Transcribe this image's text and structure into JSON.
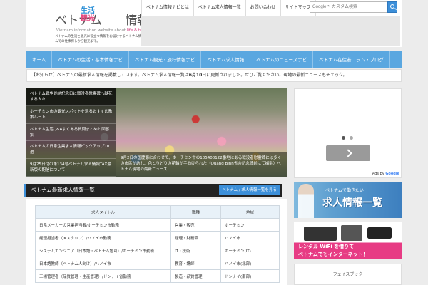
{
  "header": {
    "logo_main": "ベトナム　　情報ナビ",
    "logo_stack_top": "生活",
    "logo_stack_bottom": "観光",
    "logo_tagline_prefix": "Vietnam information website about ",
    "logo_tagline_accent": "life & travel",
    "site_description": "ベトナムの生活と観光に役立つ情報をお届けするベトナム情報サイト。ベトナムでの仕事探しから観光まで。"
  },
  "top_nav": [
    {
      "label": "ベトナム情報ナビとは"
    },
    {
      "label": "ベトナム求人情報一覧"
    },
    {
      "label": "お問い合わせ"
    },
    {
      "label": "サイトマップ"
    }
  ],
  "search": {
    "placeholder": "Google™ カスタム検索",
    "value": ""
  },
  "main_nav": [
    {
      "label": "ホーム"
    },
    {
      "label": "ベトナムの生活・基本情報ナビ"
    },
    {
      "label": "ベトナム観光・旅行情報ナビ"
    },
    {
      "label": "ベトナム求人情報"
    },
    {
      "label": "ベトナムのニュースナビ"
    },
    {
      "label": "ベトナム在住者コラム・ブログ"
    }
  ],
  "ticker": {
    "prefix": "【お知らせ】ベトナムの最新求人情報を掲載しています。ベトナム求人情報一覧は",
    "highlight": "6月10",
    "suffix": "日に更新されました。ぜひご覧ください。現地の最新ニュースもチェック。"
  },
  "slider": {
    "items": [
      {
        "title": "ベトナム戦争終結記念日に戦没者慰霊碑へ献花する人々"
      },
      {
        "title": "ホーチミン市の観光スポットを巡るおすすめ散策ルート"
      },
      {
        "title": "ベトナム生活Q&Aよくある質問まとめと回答集"
      },
      {
        "title": "ベトナムの日系企業求人情報ピックアップ10選"
      },
      {
        "title": "9月25日付の第134号ベトナム求人情報TAX最新版の配信について"
      }
    ],
    "caption": "9月2日の国慶節に合わせて、ホーチミン市の105400122番地にある戦没者慰霊碑には多くの市民が訪れ、色とりどりの花輪が手向けられた（Quang Binh省の記念碑前にて撮影）ベトナム現地の最新ニュース"
  },
  "latest_jobs": {
    "title": "ベトナム最新求人情報一覧",
    "more_label": "ベトナム / 求人情報一覧を見る",
    "columns": [
      "求人タイトル",
      "職種",
      "地域"
    ],
    "rows": [
      {
        "title": "日系メーカーの営業担当者/ホーチミン市勤務",
        "job": "営業・販売",
        "area": "ホーチミン"
      },
      {
        "title": "経理担当者（JKスタッフ）/ハノイ市勤務",
        "job": "経理・財務職",
        "area": "ハノイ市"
      },
      {
        "title": "システムエンジニア（日本語・ベトナム語可）/ホーチミン市勤務",
        "job": "IT・技術",
        "area": "ホーチミン(IT)"
      },
      {
        "title": "日本語教師（ベトナム人向け）/ハノイ市",
        "job": "教育・講師",
        "area": "ハノイ市(北部)"
      },
      {
        "title": "工場管理者（品質管理・生産管理）/ドンナイ省勤務",
        "job": "製造・品質管理",
        "area": "ドンナイ(南部)"
      }
    ]
  },
  "ads": {
    "ads_by_prefix": "Ads by ",
    "ads_by_brand": "Google"
  },
  "banner_jobs": {
    "line1": "ベトナムで働きたい！",
    "line2": "求人情報一覧"
  },
  "banner_wifi": {
    "line1": "レンタル WiFi を借りて",
    "line2": "ベトナムでもインターネット！"
  },
  "social_box": {
    "label": "フェイスブック"
  },
  "colors": {
    "accent_blue": "#3c8fd9",
    "nav_blue": "#5aa7e0",
    "pink": "#e73b84"
  }
}
